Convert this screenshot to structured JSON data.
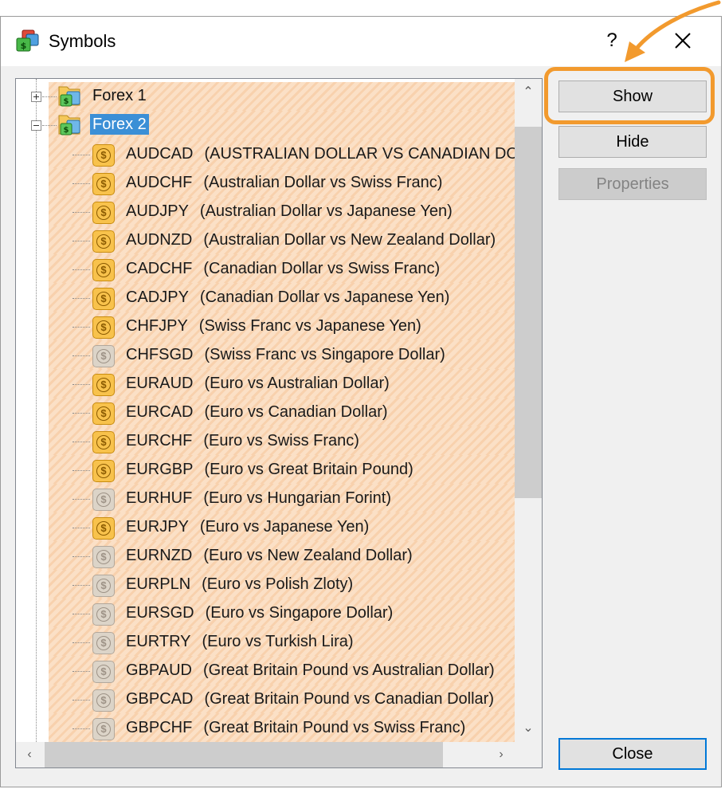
{
  "window": {
    "title": "Symbols",
    "help_label": "?"
  },
  "tree": {
    "folders": [
      {
        "label": "Forex 1",
        "expanded": false,
        "selected": false
      },
      {
        "label": "Forex 2",
        "expanded": true,
        "selected": true
      }
    ],
    "symbols": [
      {
        "code": "AUDCAD",
        "desc": "(AUSTRALIAN DOLLAR VS CANADIAN DOLLAR)",
        "active": true
      },
      {
        "code": "AUDCHF",
        "desc": "(Australian Dollar vs Swiss Franc)",
        "active": true
      },
      {
        "code": "AUDJPY",
        "desc": "(Australian Dollar vs Japanese Yen)",
        "active": true
      },
      {
        "code": "AUDNZD",
        "desc": "(Australian Dollar vs New Zealand Dollar)",
        "active": true
      },
      {
        "code": "CADCHF",
        "desc": "(Canadian Dollar vs Swiss Franc)",
        "active": true
      },
      {
        "code": "CADJPY",
        "desc": "(Canadian Dollar vs Japanese Yen)",
        "active": true
      },
      {
        "code": "CHFJPY",
        "desc": "(Swiss Franc vs Japanese Yen)",
        "active": true
      },
      {
        "code": "CHFSGD",
        "desc": "(Swiss Franc vs Singapore Dollar)",
        "active": false
      },
      {
        "code": "EURAUD",
        "desc": "(Euro vs Australian Dollar)",
        "active": true
      },
      {
        "code": "EURCAD",
        "desc": "(Euro vs Canadian Dollar)",
        "active": true
      },
      {
        "code": "EURCHF",
        "desc": "(Euro vs Swiss Franc)",
        "active": true
      },
      {
        "code": "EURGBP",
        "desc": "(Euro vs Great Britain Pound)",
        "active": true
      },
      {
        "code": "EURHUF",
        "desc": "(Euro vs Hungarian Forint)",
        "active": false
      },
      {
        "code": "EURJPY",
        "desc": "(Euro vs Japanese Yen)",
        "active": true
      },
      {
        "code": "EURNZD",
        "desc": "(Euro vs New Zealand Dollar)",
        "active": false
      },
      {
        "code": "EURPLN",
        "desc": "(Euro vs Polish Zloty)",
        "active": false
      },
      {
        "code": "EURSGD",
        "desc": "(Euro vs Singapore Dollar)",
        "active": false
      },
      {
        "code": "EURTRY",
        "desc": "(Euro vs Turkish Lira)",
        "active": false
      },
      {
        "code": "GBPAUD",
        "desc": "(Great Britain Pound vs Australian Dollar)",
        "active": false
      },
      {
        "code": "GBPCAD",
        "desc": "(Great Britain Pound vs Canadian Dollar)",
        "active": false
      },
      {
        "code": "GBPCHF",
        "desc": "(Great Britain Pound vs Swiss Franc)",
        "active": false
      }
    ]
  },
  "buttons": {
    "show": "Show",
    "hide": "Hide",
    "properties": "Properties",
    "close": "Close"
  },
  "icons": {
    "dollar_glyph": "$",
    "scroll_up": "⌃",
    "scroll_down": "⌄",
    "scroll_left": "‹",
    "scroll_right": "›"
  },
  "colors": {
    "highlight": "#f29a2e",
    "selection": "#3b8fd6",
    "active_symbol": "#f8c24c",
    "inactive_symbol": "#dcd4c8"
  }
}
